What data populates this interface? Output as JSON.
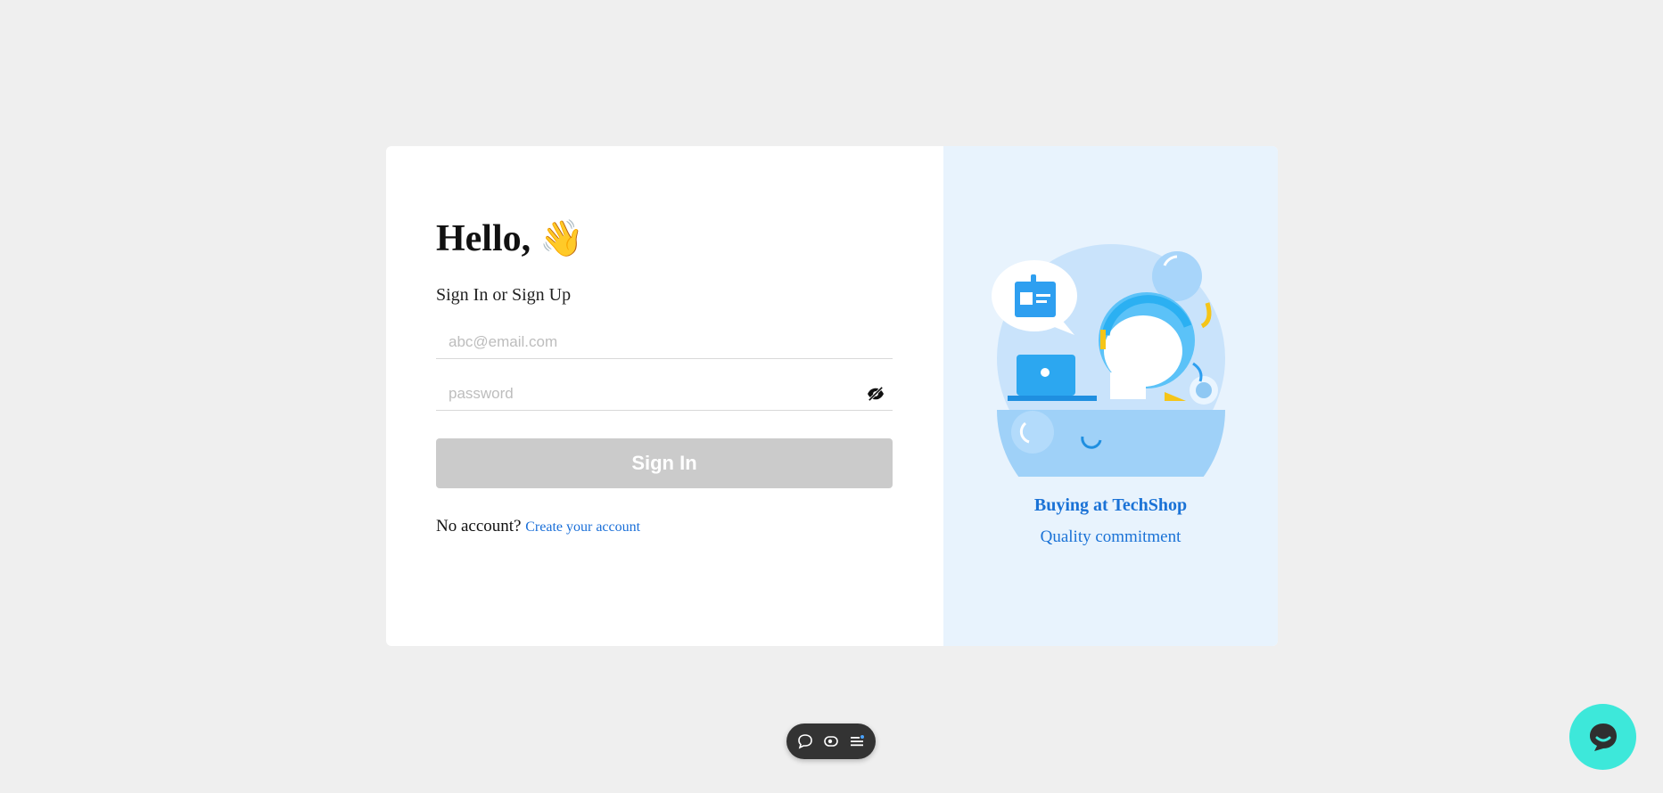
{
  "login": {
    "greeting": "Hello,",
    "wave_emoji": "👋",
    "subtitle": "Sign In or Sign Up",
    "email_placeholder": "abc@email.com",
    "password_placeholder": "password",
    "signin_label": "Sign In",
    "no_account_text": "No account?",
    "create_account_link": "Create your account"
  },
  "promo": {
    "title": "Buying at TechShop",
    "subtitle": "Quality commitment",
    "illustration": "customer-service-illustration"
  },
  "toolbar": {
    "icons": [
      "chat-bubble-icon",
      "eye-toggle-icon",
      "menu-list-icon"
    ]
  },
  "chat_widget": {
    "icon": "chat-bubble-icon",
    "color": "#3de8da"
  },
  "colors": {
    "accent": "#1a72d6",
    "button_disabled": "#cbcbcb",
    "panel_bg": "#e8f3fd"
  }
}
